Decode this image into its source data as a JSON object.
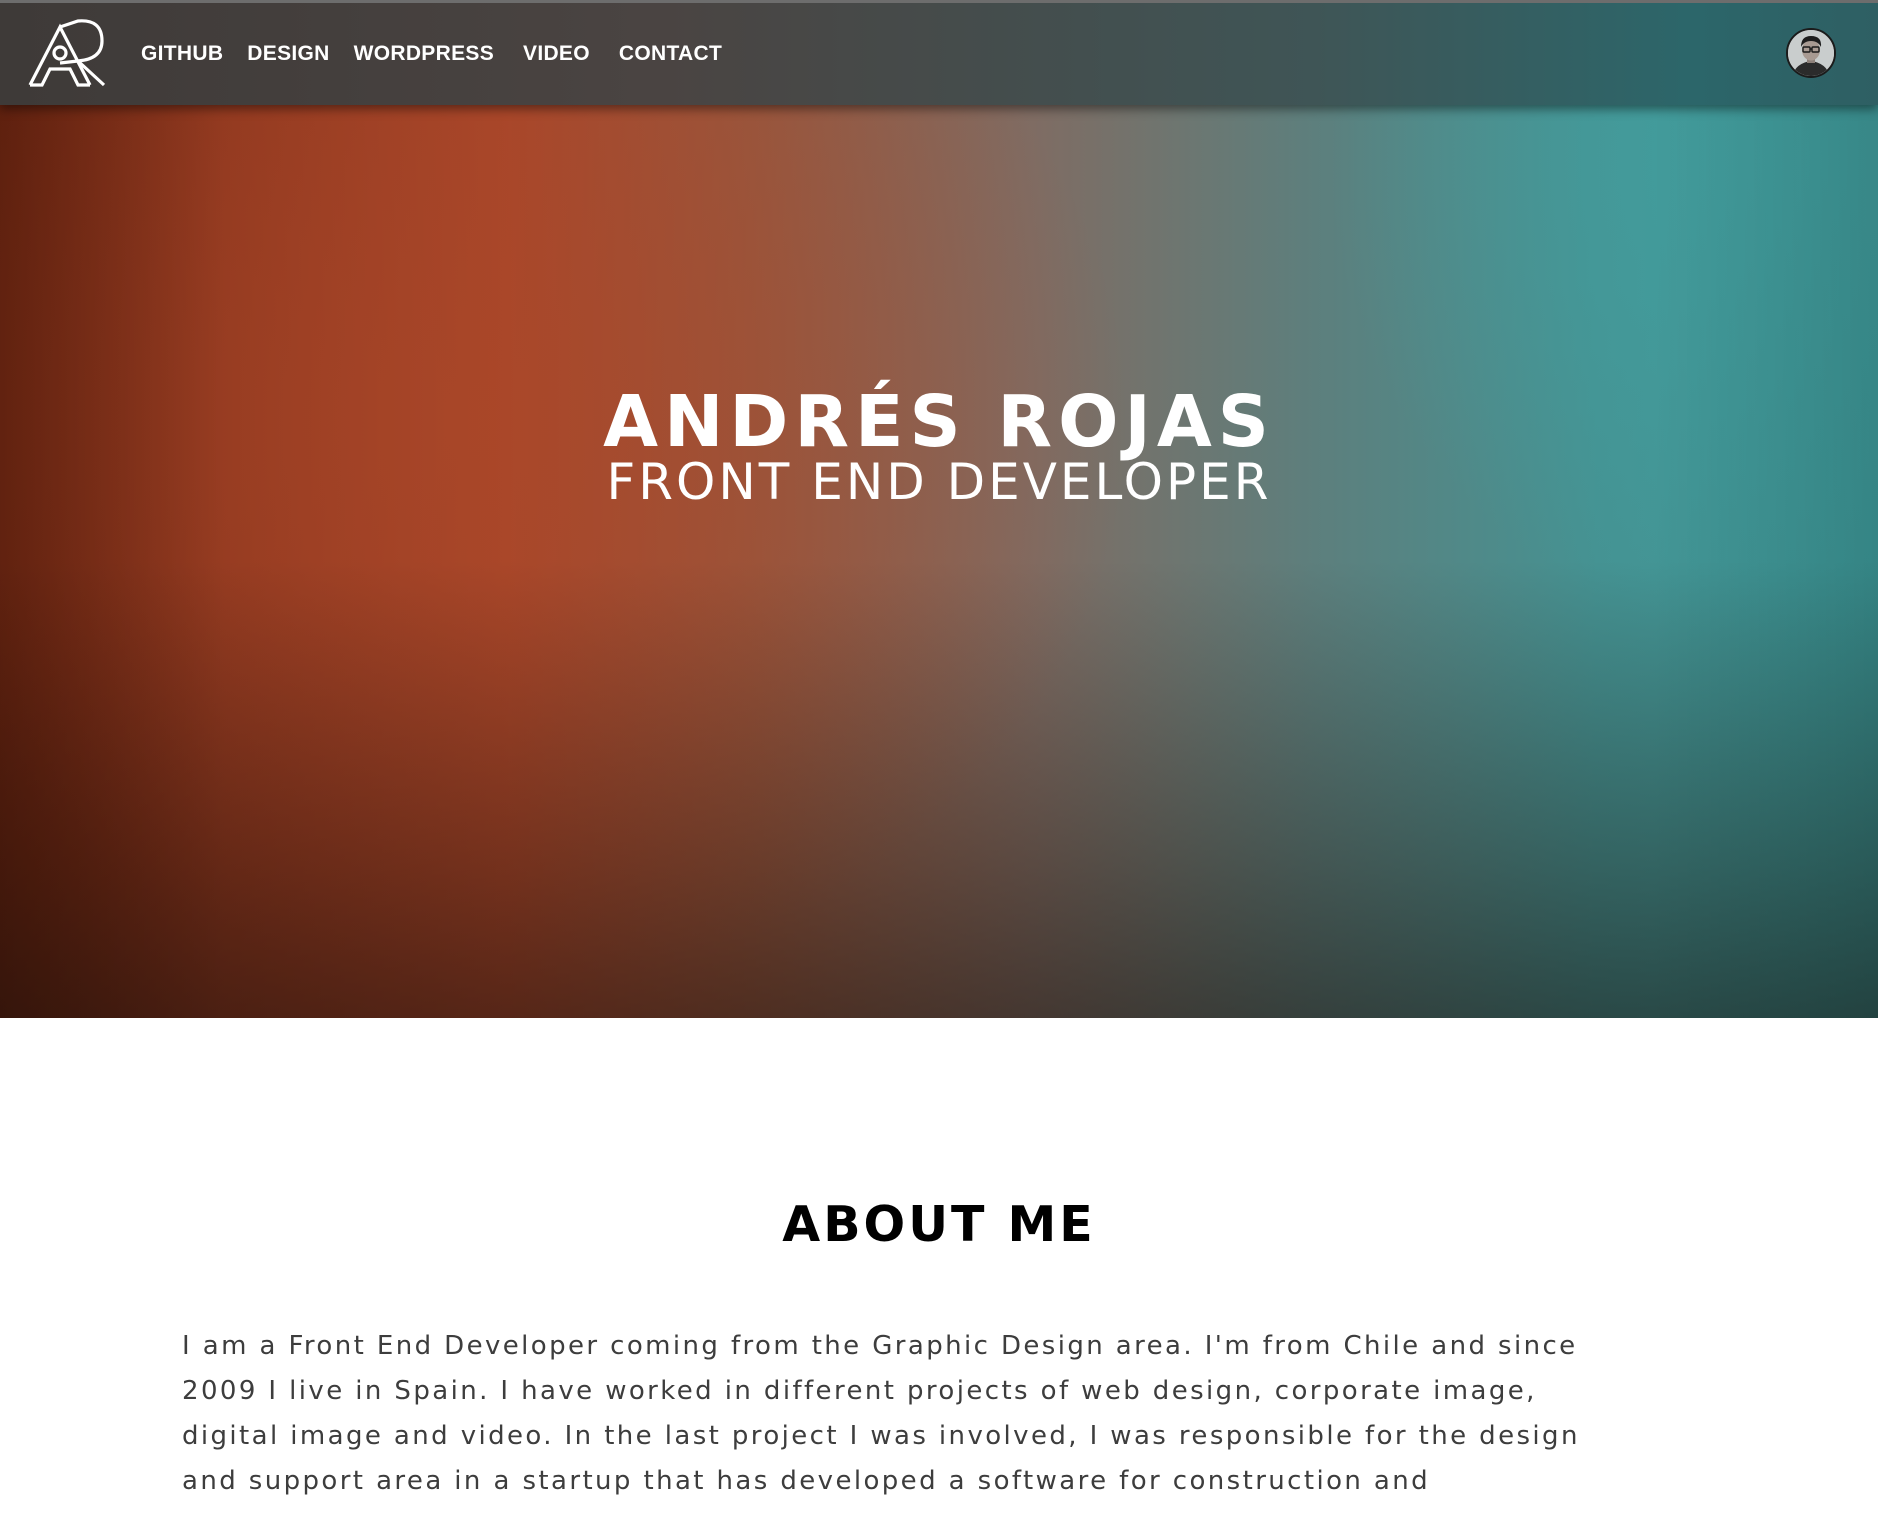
{
  "nav": {
    "logo": "AR",
    "links": [
      "GITHUB",
      "DESIGN",
      "WORDPRESS",
      "VIDEO",
      "CONTACT"
    ]
  },
  "hero": {
    "title": "ANDRÉS ROJAS",
    "subtitle": "FRONT END DEVELOPER"
  },
  "about": {
    "heading": "ABOUT ME",
    "lines": [
      "I am a Front End Developer coming from the Graphic Design area. I'm from Chile and since",
      "2009 I live in Spain. I have worked in different projects of web design, corporate image,",
      "digital image and video. In the last project I was involved, I was responsible for the design",
      "and support area in a startup that has developed a software for construction and"
    ]
  },
  "icons": {
    "logo": "ar-monogram-logo",
    "avatar": "profile-avatar"
  },
  "colors": {
    "hero_warm": "#a8462a",
    "hero_cool": "#3d9b9b",
    "nav_text": "#ffffff",
    "about_heading": "#000000",
    "about_text": "#3d3d3d"
  }
}
